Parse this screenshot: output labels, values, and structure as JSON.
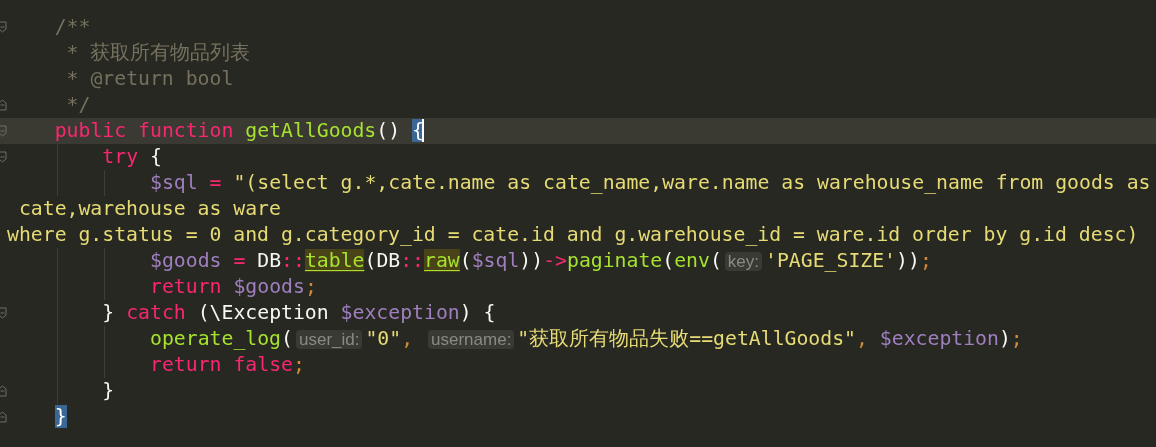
{
  "editor": {
    "lines": [
      {
        "block_start": true,
        "tokens": [
          {
            "kind": "comment",
            "text": "/**"
          }
        ]
      },
      {
        "kind": "continuation",
        "tokens": [
          {
            "kind": "comment",
            "text": "* 获取所有物品列表"
          }
        ]
      },
      {
        "kind": "continuation",
        "tokens": [
          {
            "kind": "comment",
            "text": "* @return bool"
          }
        ]
      },
      {
        "kind": "continuation",
        "block_end": true,
        "tokens": [
          {
            "kind": "comment",
            "text": "*/"
          }
        ]
      },
      {
        "block_start": true,
        "current": true,
        "tokens": [
          {
            "kind": "keyword",
            "text": "public"
          },
          {
            "kind": "keyword",
            "text": "function",
            "space_before": true
          },
          {
            "kind": "function",
            "text": "getAllGoods",
            "space_before": true
          },
          {
            "kind": "plain",
            "text": "()"
          },
          {
            "kind": "brace-match",
            "text": "{",
            "space_before": true,
            "caret": true
          }
        ],
        "children": [
          {
            "block_start": true,
            "tokens": [
              {
                "kind": "keyword",
                "text": "try"
              },
              {
                "kind": "plain",
                "text": "{",
                "space_before": true
              }
            ],
            "children": [
              {
                "tokens": [
                  {
                    "kind": "variable",
                    "text": "$sql"
                  },
                  {
                    "kind": "operator",
                    "text": "=",
                    "space_before": true
                  },
                  {
                    "kind": "string",
                    "text": "\"(select g.*,cate.name as cate_name,ware.name as warehouse_name from goods as",
                    "space_before": true
                  }
                ]
              },
              {
                "kind": "wrap-continuation",
                "tokens": [
                  {
                    "kind": "string",
                    "text": "cate,warehouse as ware"
                  }
                ]
              },
              {
                "kind": "wrap",
                "tokens": [
                  {
                    "kind": "string",
                    "text": "where g.status = 0 and g.category_id = cate.id and g.warehouse_id = ware.id order by g.id desc)"
                  }
                ]
              },
              {
                "tokens": [
                  {
                    "kind": "variable",
                    "text": "$goods"
                  },
                  {
                    "kind": "operator",
                    "text": "=",
                    "space_before": true
                  },
                  {
                    "kind": "plain",
                    "text": "DB",
                    "space_before": true
                  },
                  {
                    "kind": "operator",
                    "text": "::"
                  },
                  {
                    "kind": "usage",
                    "text": "table"
                  },
                  {
                    "kind": "plain",
                    "text": "(DB"
                  },
                  {
                    "kind": "operator",
                    "text": "::"
                  },
                  {
                    "kind": "usage",
                    "text": "raw"
                  },
                  {
                    "kind": "plain",
                    "text": "("
                  },
                  {
                    "kind": "variable",
                    "text": "$sql"
                  },
                  {
                    "kind": "plain",
                    "text": "))"
                  },
                  {
                    "kind": "operator",
                    "text": "->"
                  },
                  {
                    "kind": "function",
                    "text": "paginate"
                  },
                  {
                    "kind": "plain",
                    "text": "("
                  },
                  {
                    "kind": "function",
                    "text": "env"
                  },
                  {
                    "kind": "plain",
                    "text": "("
                  },
                  {
                    "kind": "hint",
                    "text": "key:"
                  },
                  {
                    "kind": "string",
                    "text": "'PAGE_SIZE'"
                  },
                  {
                    "kind": "plain",
                    "text": "))"
                  },
                  {
                    "kind": "punctuation",
                    "text": ";"
                  }
                ]
              },
              {
                "tokens": [
                  {
                    "kind": "keyword",
                    "text": "return"
                  },
                  {
                    "kind": "variable",
                    "text": "$goods",
                    "space_before": true
                  },
                  {
                    "kind": "punctuation",
                    "text": ";"
                  }
                ]
              }
            ]
          },
          {
            "block_start": true,
            "tokens": [
              {
                "kind": "plain",
                "text": "}"
              },
              {
                "kind": "keyword",
                "text": "catch",
                "space_before": true
              },
              {
                "kind": "plain",
                "text": "(\\Exception",
                "space_before": true
              },
              {
                "kind": "variable",
                "text": "$exception",
                "space_before": true
              },
              {
                "kind": "plain",
                "text": ")"
              },
              {
                "kind": "plain",
                "text": "{",
                "space_before": true
              }
            ],
            "children": [
              {
                "tokens": [
                  {
                    "kind": "function",
                    "text": "operate_log"
                  },
                  {
                    "kind": "plain",
                    "text": "("
                  },
                  {
                    "kind": "hint",
                    "text": "user_id:"
                  },
                  {
                    "kind": "string",
                    "text": "\"0\""
                  },
                  {
                    "kind": "punctuation",
                    "text": ","
                  },
                  {
                    "kind": "hint",
                    "text": "username:",
                    "space_before": true
                  },
                  {
                    "kind": "string",
                    "text": "\"获取所有物品失败==getAllGoods\""
                  },
                  {
                    "kind": "punctuation",
                    "text": ","
                  },
                  {
                    "kind": "variable",
                    "text": "$exception",
                    "space_before": true
                  },
                  {
                    "kind": "plain",
                    "text": ")"
                  },
                  {
                    "kind": "punctuation",
                    "text": ";"
                  }
                ]
              },
              {
                "tokens": [
                  {
                    "kind": "keyword",
                    "text": "return"
                  },
                  {
                    "kind": "keyword",
                    "text": "false",
                    "space_before": true
                  },
                  {
                    "kind": "punctuation",
                    "text": ";"
                  }
                ]
              }
            ]
          },
          {
            "block_end": true,
            "tokens": [
              {
                "kind": "plain",
                "text": "}"
              }
            ]
          }
        ]
      },
      {
        "block_end": true,
        "tokens": [
          {
            "kind": "brace-match",
            "text": "}"
          }
        ]
      }
    ]
  }
}
